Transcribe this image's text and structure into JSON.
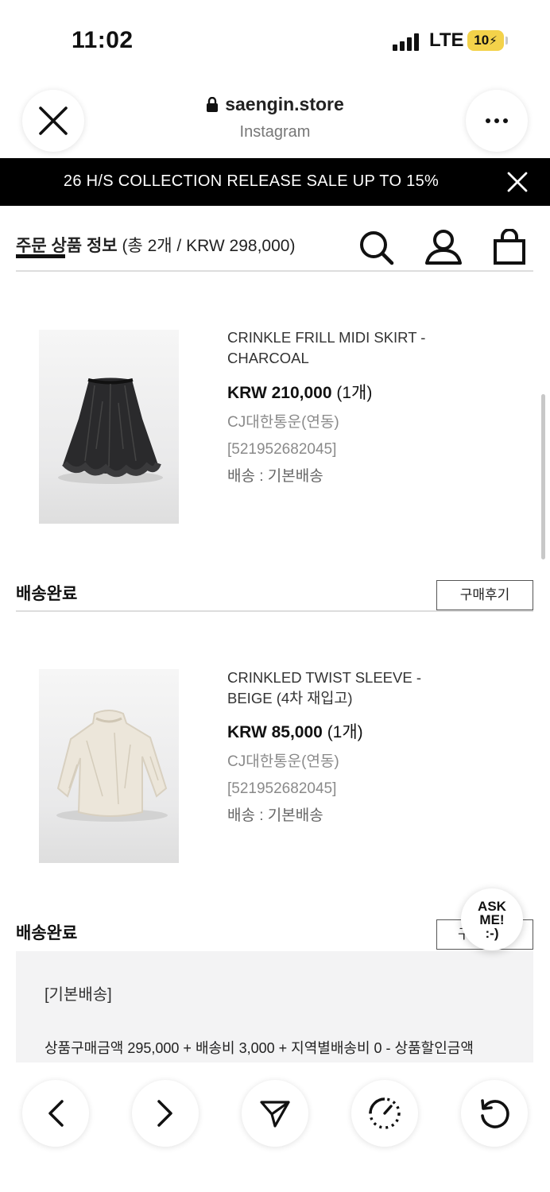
{
  "status_bar": {
    "time": "11:02",
    "network": "LTE",
    "battery": "10"
  },
  "browser": {
    "url": "saengin.store",
    "source": "Instagram"
  },
  "banner": {
    "text": "26 H/S COLLECTION RELEASE SALE UP TO 15%"
  },
  "order_header": {
    "label": "주문 상품 정보",
    "summary": "(총 2개 / KRW 298,000)"
  },
  "products": [
    {
      "name": "CRINKLE FRILL MIDI SKIRT - CHARCOAL",
      "price": "KRW 210,000",
      "qty": "(1개)",
      "carrier": "CJ대한통운(연동)",
      "tracking": "[521952682045]",
      "shipping": "배송 : 기본배송",
      "status": "배송완료",
      "review_label": "구매후기"
    },
    {
      "name": "CRINKLED TWIST SLEEVE - BEIGE (4차 재입고)",
      "price": "KRW 85,000",
      "qty": "(1개)",
      "carrier": "CJ대한통운(연동)",
      "tracking": "[521952682045]",
      "shipping": "배송 : 기본배송",
      "status": "배송완료",
      "review_label": "구"
    }
  ],
  "summary": {
    "title": "[기본배송]",
    "line": "상품구매금액 295,000 + 배송비 3,000 + 지역별배송비 0 - 상품할인금액"
  },
  "ask_me": {
    "line1": "ASK",
    "line2": "ME!",
    "line3": ":-)"
  },
  "colors": {
    "banner_bg": "#000000",
    "battery": "#f3d24a",
    "summary_bg": "#f3f3f4"
  }
}
